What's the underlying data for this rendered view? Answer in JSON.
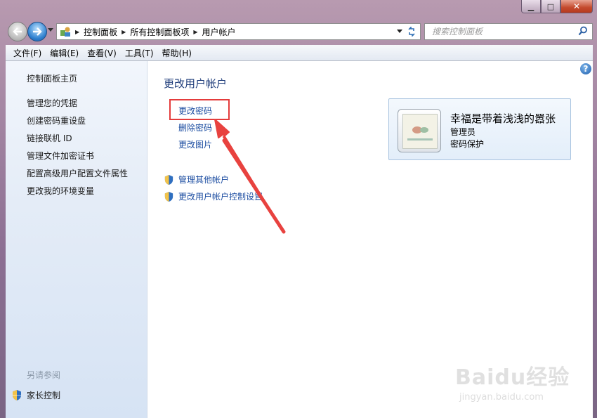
{
  "window": {
    "minimize_glyph": "▁",
    "maximize_glyph": "□",
    "close_glyph": "✕"
  },
  "address_bar": {
    "icon": "control-panel-icon",
    "breadcrumbs": [
      "控制面板",
      "所有控制面板项",
      "用户帐户"
    ]
  },
  "search": {
    "placeholder": "搜索控制面板"
  },
  "menu": {
    "items": [
      "文件(F)",
      "编辑(E)",
      "查看(V)",
      "工具(T)",
      "帮助(H)"
    ]
  },
  "sidebar": {
    "home": "控制面板主页",
    "links": [
      "管理您的凭据",
      "创建密码重设盘",
      "链接联机 ID",
      "管理文件加密证书",
      "配置高级用户配置文件属性",
      "更改我的环境变量"
    ],
    "see_also_title": "另请参阅",
    "see_also": [
      "家长控制"
    ]
  },
  "main": {
    "title": "更改用户帐户",
    "tasks": [
      "更改密码",
      "删除密码",
      "更改图片"
    ],
    "shield_tasks": [
      "管理其他帐户",
      "更改用户帐户控制设置"
    ]
  },
  "user_card": {
    "name": "幸福是带着浅浅的嚣张",
    "role": "管理员",
    "status": "密码保护"
  },
  "watermark": {
    "main": "Baidu经验",
    "sub": "jingyan.baidu.com"
  },
  "colors": {
    "link": "#1c4da1",
    "title": "#1e3c7a",
    "highlight": "#e43b3b"
  }
}
